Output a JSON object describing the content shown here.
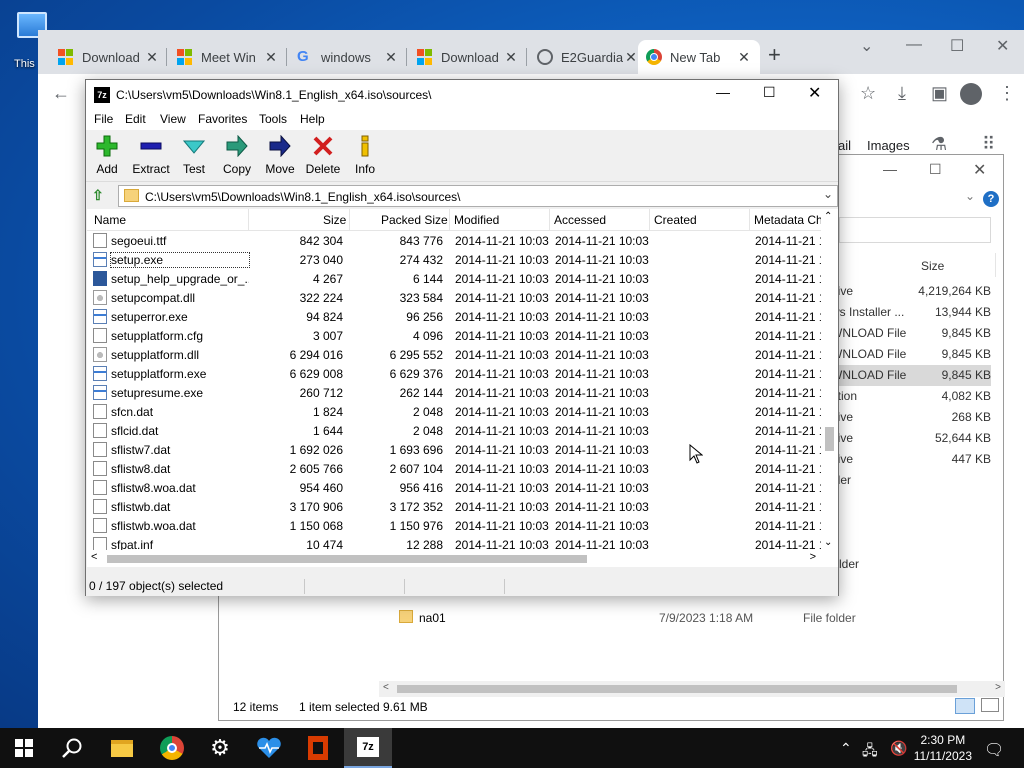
{
  "desktop": {
    "icon_label": "This"
  },
  "browser": {
    "tabs": [
      {
        "title": "Download",
        "icon": "microsoft-icon"
      },
      {
        "title": "Meet Win",
        "icon": "microsoft-icon"
      },
      {
        "title": "windows",
        "icon": "google-icon"
      },
      {
        "title": "Download",
        "icon": "microsoft-icon"
      },
      {
        "title": "E2Guardia",
        "icon": "globe-icon"
      },
      {
        "title": "New Tab",
        "icon": "chrome-icon"
      }
    ],
    "page_links": {
      "mail": "ail",
      "images": "Images"
    }
  },
  "sevenzip": {
    "title": "C:\\Users\\vm5\\Downloads\\Win8.1_English_x64.iso\\sources\\",
    "menu": [
      "File",
      "Edit",
      "View",
      "Favorites",
      "Tools",
      "Help"
    ],
    "tools": [
      {
        "label": "Add",
        "icon": "plus-icon",
        "color": "#1fa81f"
      },
      {
        "label": "Extract",
        "icon": "minus-icon",
        "color": "#1f1fa8"
      },
      {
        "label": "Test",
        "icon": "check-icon",
        "color": "#25b3b3"
      },
      {
        "label": "Copy",
        "icon": "arrow-right-icon",
        "color": "#2a9a7a"
      },
      {
        "label": "Move",
        "icon": "arrow-right-icon",
        "color": "#1a2a8a"
      },
      {
        "label": "Delete",
        "icon": "x-icon",
        "color": "#d21f1f"
      },
      {
        "label": "Info",
        "icon": "info-icon",
        "color": "#e0b000"
      }
    ],
    "address": "C:\\Users\\vm5\\Downloads\\Win8.1_English_x64.iso\\sources\\",
    "columns": {
      "name": "Name",
      "size": "Size",
      "packed": "Packed Size",
      "modified": "Modified",
      "accessed": "Accessed",
      "created": "Created",
      "metadata": "Metadata Ch"
    },
    "files": [
      {
        "name": "segoeui.ttf",
        "size": "842 304",
        "packed": "843 776",
        "modified": "2014-11-21 10:03",
        "accessed": "2014-11-21 10:03",
        "meta": "2014-11-21 1",
        "type": "file"
      },
      {
        "name": "setup.exe",
        "size": "273 040",
        "packed": "274 432",
        "modified": "2014-11-21 10:03",
        "accessed": "2014-11-21 10:03",
        "meta": "2014-11-21 1",
        "type": "exe"
      },
      {
        "name": "setup_help_upgrade_or_...",
        "size": "4 267",
        "packed": "6 144",
        "modified": "2014-11-21 10:03",
        "accessed": "2014-11-21 10:03",
        "meta": "2014-11-21 1",
        "type": "word"
      },
      {
        "name": "setupcompat.dll",
        "size": "322 224",
        "packed": "323 584",
        "modified": "2014-11-21 10:03",
        "accessed": "2014-11-21 10:03",
        "meta": "2014-11-21 1",
        "type": "dll"
      },
      {
        "name": "setuperror.exe",
        "size": "94 824",
        "packed": "96 256",
        "modified": "2014-11-21 10:03",
        "accessed": "2014-11-21 10:03",
        "meta": "2014-11-21 1",
        "type": "exe"
      },
      {
        "name": "setupplatform.cfg",
        "size": "3 007",
        "packed": "4 096",
        "modified": "2014-11-21 10:03",
        "accessed": "2014-11-21 10:03",
        "meta": "2014-11-21 1",
        "type": "file"
      },
      {
        "name": "setupplatform.dll",
        "size": "6 294 016",
        "packed": "6 295 552",
        "modified": "2014-11-21 10:03",
        "accessed": "2014-11-21 10:03",
        "meta": "2014-11-21 1",
        "type": "dll"
      },
      {
        "name": "setupplatform.exe",
        "size": "6 629 008",
        "packed": "6 629 376",
        "modified": "2014-11-21 10:03",
        "accessed": "2014-11-21 10:03",
        "meta": "2014-11-21 1",
        "type": "exe"
      },
      {
        "name": "setupresume.exe",
        "size": "260 712",
        "packed": "262 144",
        "modified": "2014-11-21 10:03",
        "accessed": "2014-11-21 10:03",
        "meta": "2014-11-21 1",
        "type": "exe"
      },
      {
        "name": "sfcn.dat",
        "size": "1 824",
        "packed": "2 048",
        "modified": "2014-11-21 10:03",
        "accessed": "2014-11-21 10:03",
        "meta": "2014-11-21 1",
        "type": "file"
      },
      {
        "name": "sflcid.dat",
        "size": "1 644",
        "packed": "2 048",
        "modified": "2014-11-21 10:03",
        "accessed": "2014-11-21 10:03",
        "meta": "2014-11-21 1",
        "type": "file"
      },
      {
        "name": "sflistw7.dat",
        "size": "1 692 026",
        "packed": "1 693 696",
        "modified": "2014-11-21 10:03",
        "accessed": "2014-11-21 10:03",
        "meta": "2014-11-21 1",
        "type": "file"
      },
      {
        "name": "sflistw8.dat",
        "size": "2 605 766",
        "packed": "2 607 104",
        "modified": "2014-11-21 10:03",
        "accessed": "2014-11-21 10:03",
        "meta": "2014-11-21 1",
        "type": "file"
      },
      {
        "name": "sflistw8.woa.dat",
        "size": "954 460",
        "packed": "956 416",
        "modified": "2014-11-21 10:03",
        "accessed": "2014-11-21 10:03",
        "meta": "2014-11-21 1",
        "type": "file"
      },
      {
        "name": "sflistwb.dat",
        "size": "3 170 906",
        "packed": "3 172 352",
        "modified": "2014-11-21 10:03",
        "accessed": "2014-11-21 10:03",
        "meta": "2014-11-21 1",
        "type": "file"
      },
      {
        "name": "sflistwb.woa.dat",
        "size": "1 150 068",
        "packed": "1 150 976",
        "modified": "2014-11-21 10:03",
        "accessed": "2014-11-21 10:03",
        "meta": "2014-11-21 1",
        "type": "file"
      },
      {
        "name": "sfpat.inf",
        "size": "10 474",
        "packed": "12 288",
        "modified": "2014-11-21 10:03",
        "accessed": "2014-11-21 10:03",
        "meta": "2014-11-21 1",
        "type": "file"
      }
    ],
    "status": "0 / 197 object(s) selected"
  },
  "explorer": {
    "size_header": "Size",
    "rows": [
      {
        "type": "hive",
        "size": "4,219,264 KB"
      },
      {
        "type": "ws Installer ...",
        "size": "13,944 KB"
      },
      {
        "type": "WNLOAD File",
        "size": "9,845 KB"
      },
      {
        "type": "WNLOAD File",
        "size": "9,845 KB"
      },
      {
        "type": "WNLOAD File",
        "size": "9,845 KB"
      },
      {
        "type": "ation",
        "size": "4,082 KB"
      },
      {
        "type": "hive",
        "size": "268 KB"
      },
      {
        "type": "hive",
        "size": "52,644 KB"
      },
      {
        "type": "hive",
        "size": "447 KB"
      },
      {
        "type": "lder",
        "size": ""
      }
    ],
    "folder_row": {
      "name": "na01",
      "date": "7/9/2023 1:18 AM",
      "type": "File folder"
    },
    "folder_label_above": "lder",
    "status_items": "12 items",
    "status_selected": "1 item selected",
    "status_size": "9.61 MB"
  },
  "taskbar": {
    "time": "2:30 PM",
    "date": "11/11/2023"
  }
}
